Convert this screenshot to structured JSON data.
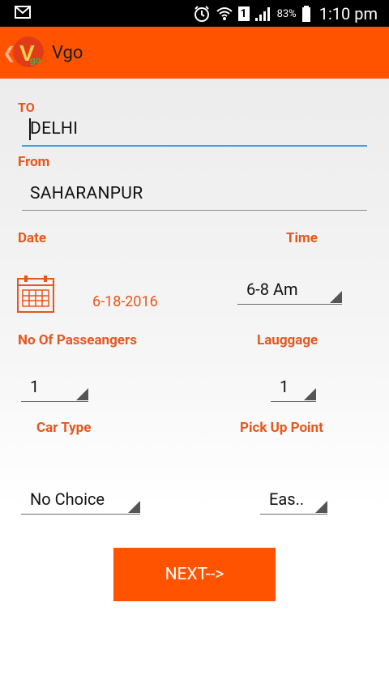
{
  "status": {
    "battery": "83%",
    "time": "1:10 pm",
    "sim_label": "1"
  },
  "app": {
    "title": "Vgo",
    "logo_text": "V",
    "logo_sub": "go"
  },
  "form": {
    "to_label": "TO",
    "to_value": "DELHI",
    "from_label": "From",
    "from_value": "SAHARANPUR",
    "date_label": "Date",
    "date_value": "6-18-2016",
    "time_label": "Time",
    "time_value": "6-8 Am",
    "passengers_label": "No Of Passeangers",
    "passengers_value": "1",
    "luggage_label": "Lauggage",
    "luggage_value": "1",
    "cartype_label": "Car Type",
    "cartype_value": "No Choice",
    "pickup_label": "Pick Up Point",
    "pickup_value": "Eas..",
    "next_label": "NEXT-->"
  },
  "colors": {
    "accent": "#ff5300",
    "label": "#e8561c",
    "focus_line": "#3aa6d9"
  }
}
